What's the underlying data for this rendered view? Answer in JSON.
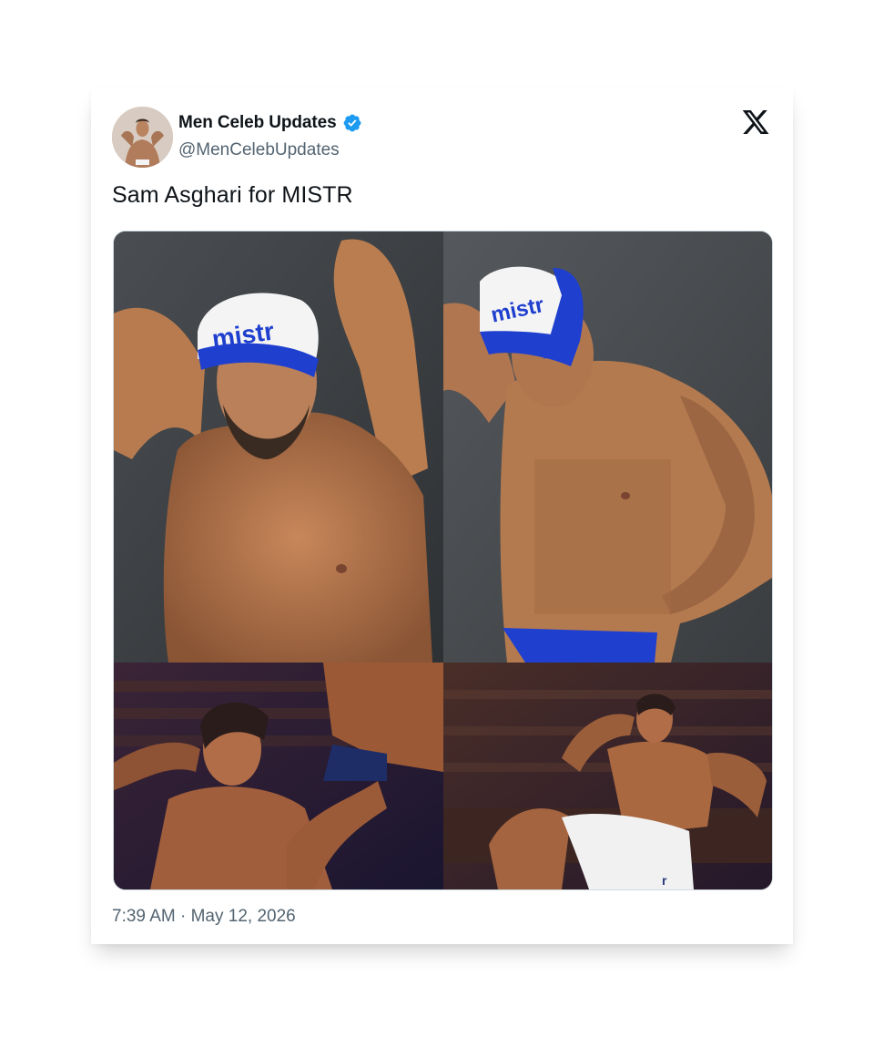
{
  "tweet": {
    "display_name": "Men Celeb Updates",
    "handle": "@MenCelebUpdates",
    "verified": true,
    "text": "Sam Asghari for MISTR",
    "timestamp": "7:39 AM · May 12, 2026",
    "cap_logo_text": "mistr",
    "towel_text": "r",
    "media": [
      {
        "label": "photo-1"
      },
      {
        "label": "photo-2"
      },
      {
        "label": "photo-3"
      },
      {
        "label": "photo-4"
      }
    ]
  },
  "colors": {
    "verified_blue": "#1d9bf0",
    "cap_blue": "#1f3fcf",
    "handle_gray": "#536471",
    "text_black": "#0f1419"
  },
  "icons": {
    "brand": "x-logo-icon",
    "verified": "verified-badge-icon"
  }
}
